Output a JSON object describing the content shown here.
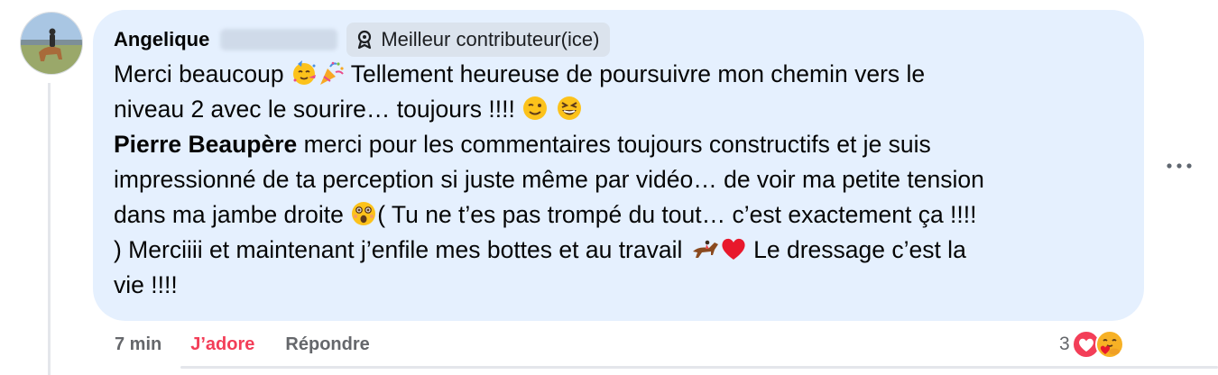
{
  "comment": {
    "author": "Angelique",
    "badge_label": "Meilleur contributeur(ice)",
    "body": {
      "line1_a": "Merci beaucoup ",
      "line1_b": " Tellement heureuse de poursuivre mon chemin vers le",
      "line2": "niveau 2 avec le sourire… toujours !!!! ",
      "mention": "Pierre Beaupère",
      "line3_rest": " merci pour les commentaires toujours constructifs et je suis",
      "line4": "impressionné de ta perception si juste même par vidéo… de voir ma petite tension",
      "line5_a": "dans ma jambe droite ",
      "line5_b": "( Tu ne t’es pas trompé du tout… c’est exactement ça !!!!",
      "line6_a": ") Merciiii et maintenant j’enfile mes bottes et au travail ",
      "line6_b": " Le dressage c’est la",
      "line7": "vie !!!!"
    },
    "emojis": [
      "partying-face",
      "party-popper",
      "winking-face",
      "grinning-squinting-face",
      "astonished-face",
      "horse-racing",
      "red-heart"
    ],
    "timestamp": "7 min",
    "like_label": "J’adore",
    "reply_label": "Répondre",
    "reaction_count": "3",
    "reaction_icons": [
      "love-reaction-icon",
      "care-reaction-icon"
    ]
  },
  "colors": {
    "bubble": "#e5f0fe",
    "badge": "#dbe3ed",
    "like_active": "#f33e58",
    "secondary_text": "#65676b"
  }
}
